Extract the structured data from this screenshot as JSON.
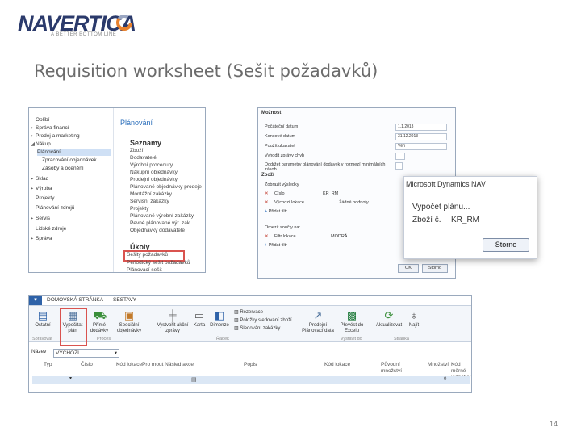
{
  "logo": {
    "brand": "NAVERTICA",
    "tagline": "A BETTER BOTTOM LINE"
  },
  "slide": {
    "title": "Requisition worksheet (Sešit požadavků)",
    "page_number": "14"
  },
  "navigation": {
    "left_items": [
      {
        "label": "Oblíbí",
        "expanded": false
      },
      {
        "label": "Správa financí",
        "expanded": false
      },
      {
        "label": "Prodej a marketing",
        "expanded": false
      },
      {
        "label": "Nákup",
        "expanded": true
      },
      {
        "label": "Plánování",
        "selected": true
      },
      {
        "label": "Zpracování objednávek"
      },
      {
        "label": "Zásoby a ocenění"
      },
      {
        "label": "Sklad"
      },
      {
        "label": "Výroba"
      },
      {
        "label": "Projekty"
      },
      {
        "label": "Plánování zdrojů"
      },
      {
        "label": "Servis"
      },
      {
        "label": "Lidské zdroje"
      },
      {
        "label": "Správa"
      }
    ],
    "section_title": "Plánování",
    "lists_title": "Seznamy",
    "lists": [
      "Zboží",
      "Dodavatelé",
      "Výrobní procedury",
      "Nákupní objednávky",
      "Prodejní objednávky",
      "Plánované objednávky prodeje",
      "Montážní zakázky",
      "Servisní zakázky",
      "Projekty",
      "Plánované výrobní zakázky",
      "Pevné plánované výr. zak.",
      "Objednávky dodavatele"
    ],
    "tasks_title": "Úkoly",
    "tasks": [
      "Sešity požadavků",
      "Periodický sešit požadavků",
      "Plánovací sešit"
    ]
  },
  "dialog": {
    "general_section": "Možnost",
    "fields": [
      {
        "label": "Počáteční datum",
        "value": "1.1.2013"
      },
      {
        "label": "Koncové datum",
        "value": "31.12.2013"
      },
      {
        "label": "Použít ukazatel",
        "value": "Věři"
      },
      {
        "label": "Vyhodit zprávy chyb",
        "value": ""
      }
    ],
    "checkbox_label": "Dodržet parametry plánování dodávek v rozmezí minimálních zásob",
    "item_section": "Zboží",
    "filter_header": "Zobrazit výsledky",
    "filter_rows": [
      {
        "field": "Číslo",
        "value": "KR_RM"
      },
      {
        "field": "Výchozí lokace",
        "value": "Žádné hodnoty"
      }
    ],
    "add_filter": "Přidat filtr",
    "limit_header": "Omezit součty na:",
    "limit_rows": [
      {
        "field": "Filtr lokace",
        "value": "MODRÁ"
      }
    ],
    "add_filter2": "Přidat filtr",
    "ok": "OK",
    "cancel": "Storno"
  },
  "popup": {
    "title": "Microsoft Dynamics NAV",
    "calculating": "Vypočet plánu...",
    "item_label": "Zboží č.",
    "item_value": "KR_RM",
    "stop_button": "Storno"
  },
  "ribbon": {
    "tabs": [
      "DOMOVSKÁ STRÁNKA",
      "SESTAVY"
    ],
    "buttons": [
      {
        "label": "Ostatní",
        "icon": "home-icon"
      },
      {
        "label": "Vypočítat plán",
        "icon": "calculate-icon"
      },
      {
        "label": "Přímé dodávky",
        "icon": "truck-icon"
      },
      {
        "label": "Speciální objednávky",
        "icon": "order-icon"
      },
      {
        "label": "Vystvořit akční zprávy",
        "icon": "action-icon"
      },
      {
        "label": "Karta",
        "icon": "card-icon"
      },
      {
        "label": "Dimenze",
        "icon": "dimension-icon"
      },
      {
        "label": "Prodejní Plánovací data",
        "icon": "forecast-icon"
      },
      {
        "label": "Převést do Excelu",
        "icon": "excel-icon"
      },
      {
        "label": "Aktualizovat",
        "icon": "refresh-icon"
      },
      {
        "label": "Najít",
        "icon": "binoculars-icon"
      }
    ],
    "small_buttons": [
      "Rezervace",
      "Položky sledování zboží",
      "Sledování zakázky"
    ],
    "groups": [
      "Spravovat",
      "Proces",
      "Řádek",
      "Vystavit do",
      "Stránka"
    ],
    "name_label": "Název",
    "name_value": "VÝCHOZÍ",
    "columns": [
      "Typ",
      "Číslo",
      "Kód lokace",
      "Pro mout Násled akce",
      "Popis",
      "Kód lokace",
      "Původní množství",
      "Množství",
      "Kód měrné jednotky"
    ],
    "row": {
      "type": "",
      "qty": "0"
    }
  }
}
